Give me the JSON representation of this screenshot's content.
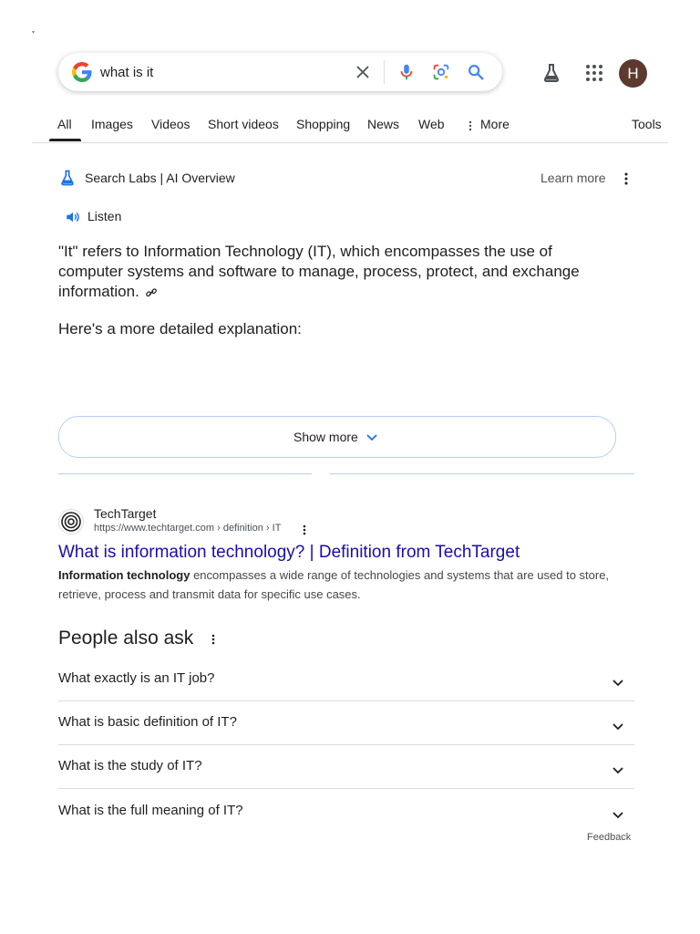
{
  "search": {
    "query": "what is it",
    "profile_initial": "H"
  },
  "tabs": [
    {
      "label": "All"
    },
    {
      "label": "Images"
    },
    {
      "label": "Videos"
    },
    {
      "label": "Short videos"
    },
    {
      "label": "Shopping"
    },
    {
      "label": "News"
    },
    {
      "label": "Web"
    },
    {
      "label": "More"
    },
    {
      "label": "Tools"
    }
  ],
  "ai_overview": {
    "header": "Search Labs | AI Overview",
    "learn_more": "Learn more",
    "listen": "Listen",
    "paragraph1": "\"It\" refers to Information Technology (IT), which encompasses the use of computer systems and software to manage, process, protect, and exchange information.",
    "paragraph2": "Here's a more detailed explanation:",
    "show_more": "Show more"
  },
  "result": {
    "site_name": "TechTarget",
    "url": "https://www.techtarget.com › definition › IT",
    "title": "What is information technology? | Definition from TechTarget",
    "snippet_bold": "Information technology",
    "snippet_rest": " encompasses a wide range of technologies and systems that are used to store, retrieve, process and transmit data for specific use cases."
  },
  "people_also_ask": {
    "title": "People also ask",
    "questions": [
      "What exactly is an IT job?",
      "What is basic definition of IT?",
      "What is the study of IT?",
      "What is the full meaning of IT?"
    ],
    "feedback": "Feedback"
  },
  "colors": {
    "link": "#1a0dab",
    "accent_blue": "#4285f4",
    "avatar": "#5d3a2e"
  },
  "icons": [
    "google-logo-icon",
    "clear-icon",
    "voice-search-icon",
    "lens-icon",
    "search-icon",
    "labs-flask-icon",
    "apps-grid-icon",
    "more-vert-icon",
    "speaker-icon",
    "link-icon",
    "chevron-down-icon"
  ]
}
